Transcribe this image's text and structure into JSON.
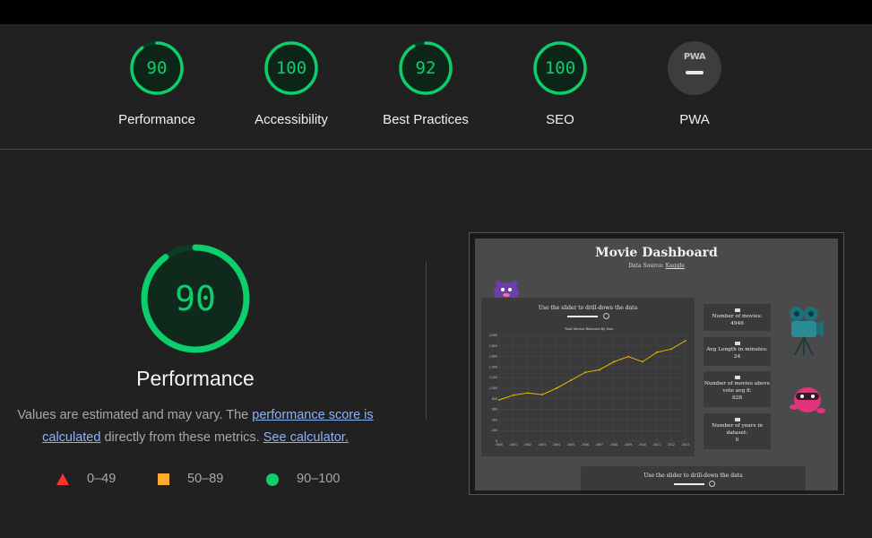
{
  "categories": [
    {
      "label": "Performance",
      "score": "90",
      "value": 0.9
    },
    {
      "label": "Accessibility",
      "score": "100",
      "value": 1.0
    },
    {
      "label": "Best Practices",
      "score": "92",
      "value": 0.92
    },
    {
      "label": "SEO",
      "score": "100",
      "value": 1.0
    },
    {
      "label": "PWA",
      "badge": "PWA"
    }
  ],
  "performance": {
    "score": "90",
    "value": 0.9,
    "title": "Performance",
    "desc_prefix": "Values are estimated and may vary. The ",
    "desc_link1": "performance score is calculated",
    "desc_middle": " directly from these metrics. ",
    "desc_link2": "See calculator."
  },
  "legend": [
    {
      "range": "0–49",
      "shape": "triangle",
      "color": "#ff3333"
    },
    {
      "range": "50–89",
      "shape": "square",
      "color": "#ffaa33"
    },
    {
      "range": "90–100",
      "shape": "circle",
      "color": "#0cce6b"
    }
  ],
  "colors": {
    "pass": "#0cce6b",
    "track": "#0b3d24",
    "background": "#212121"
  },
  "screenshot": {
    "title": "Movie Dashboard",
    "source_prefix": "Data Source: ",
    "source_link": "Kaggle",
    "slider_text": "Use the slider to drill-down the data",
    "bottom_slider_text": "Use the slider to drill-down the data",
    "chart_title": "Total Movies Released By Year",
    "stats": [
      {
        "label": "Number of movies:",
        "value": "4946"
      },
      {
        "label": "Avg Length in minutes:",
        "value": "24"
      },
      {
        "label": "Number of movies above vote avg 8:",
        "value": "828"
      },
      {
        "label": "Number of years in dataset:",
        "value": "0"
      }
    ]
  },
  "chart_data": {
    "type": "line",
    "title": "Total Movies Released By Year",
    "x": [
      "2000",
      "2001",
      "2002",
      "2003",
      "2004",
      "2005",
      "2006",
      "2007",
      "2008",
      "2009",
      "2010",
      "2011",
      "2012",
      "2013"
    ],
    "y_ticks": [
      "2,000",
      "1,800",
      "1,600",
      "1,400",
      "1,200",
      "1,000",
      "800",
      "600",
      "400",
      "200",
      "0"
    ],
    "ylim": [
      0,
      2000
    ],
    "series": [
      {
        "values": [
          780,
          870,
          910,
          880,
          1000,
          1150,
          1300,
          1350,
          1500,
          1600,
          1500,
          1680,
          1740,
          1900
        ]
      }
    ],
    "line_color": "#e6b800",
    "grid": true
  }
}
